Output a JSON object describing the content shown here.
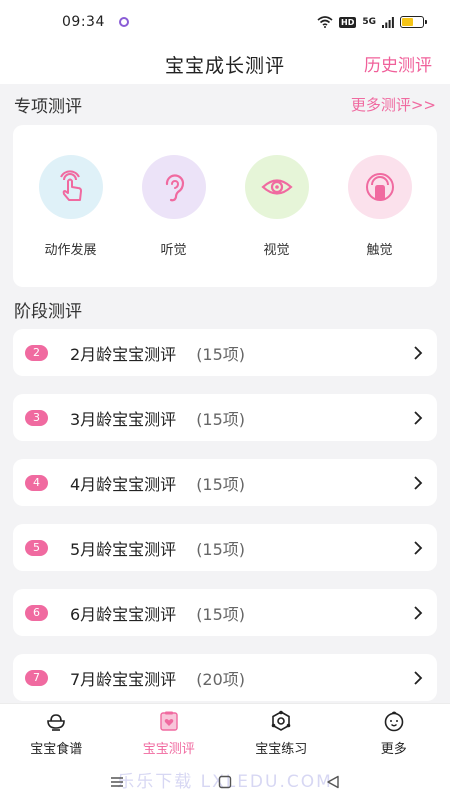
{
  "status": {
    "time": "09:34",
    "hd": "HD",
    "signal": "5G"
  },
  "header": {
    "title": "宝宝成长测评",
    "history": "历史测评"
  },
  "special": {
    "label": "专项测评",
    "more": "更多测评>>",
    "items": [
      {
        "name": "动作发展",
        "icon": "hand-tap-icon",
        "bg": "#dff1f8",
        "color": "#f06aa0"
      },
      {
        "name": "听觉",
        "icon": "ear-icon",
        "bg": "#ece3f8",
        "color": "#f06aa0"
      },
      {
        "name": "视觉",
        "icon": "eye-icon",
        "bg": "#e6f5d8",
        "color": "#f06aa0"
      },
      {
        "name": "触觉",
        "icon": "touch-icon",
        "bg": "#fbe1ec",
        "color": "#f06aa0"
      }
    ]
  },
  "stage": {
    "label": "阶段测评",
    "rows": [
      {
        "num": "2",
        "name": "2月龄宝宝测评",
        "count": "(15项)"
      },
      {
        "num": "3",
        "name": "3月龄宝宝测评",
        "count": "(15项)"
      },
      {
        "num": "4",
        "name": "4月龄宝宝测评",
        "count": "(15项)"
      },
      {
        "num": "5",
        "name": "5月龄宝宝测评",
        "count": "(15项)"
      },
      {
        "num": "6",
        "name": "6月龄宝宝测评",
        "count": "(15项)"
      },
      {
        "num": "7",
        "name": "7月龄宝宝测评",
        "count": "(20项)"
      }
    ]
  },
  "tabs": [
    {
      "label": "宝宝食谱",
      "icon": "bowl-icon",
      "active": false
    },
    {
      "label": "宝宝测评",
      "icon": "clipboard-heart-icon",
      "active": true
    },
    {
      "label": "宝宝练习",
      "icon": "hexagon-practice-icon",
      "active": false
    },
    {
      "label": "更多",
      "icon": "baby-face-icon",
      "active": false
    }
  ],
  "watermark": "乐乐下载 LXLEDU.COM",
  "colors": {
    "accent": "#f06aa0",
    "background": "#f3f3f5"
  }
}
